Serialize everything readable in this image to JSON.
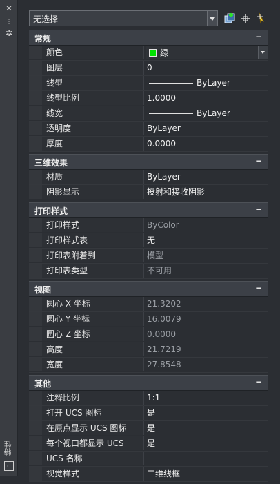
{
  "sidebar": {
    "title": "特性"
  },
  "toolbar": {
    "selection": "无选择"
  },
  "sections": {
    "general": {
      "title": "常规",
      "color": "绿",
      "color_hex": "#00e000",
      "layer_label": "图层",
      "layer": "0",
      "linetype_label": "线型",
      "linetype": "ByLayer",
      "ltscale_label": "线型比例",
      "ltscale": "1.0000",
      "lineweight_label": "线宽",
      "lineweight": "ByLayer",
      "transparency_label": "透明度",
      "transparency": "ByLayer",
      "thickness_label": "厚度",
      "thickness": "0.0000",
      "color_label": "颜色"
    },
    "three_d": {
      "title": "三维效果",
      "material_label": "材质",
      "material": "ByLayer",
      "shadow_label": "阴影显示",
      "shadow": "投射和接收阴影"
    },
    "plot": {
      "title": "打印样式",
      "style_label": "打印样式",
      "style": "ByColor",
      "table_label": "打印样式表",
      "table": "无",
      "attached_label": "打印表附着到",
      "attached": "模型",
      "type_label": "打印表类型",
      "type": "不可用"
    },
    "view": {
      "title": "视图",
      "cx_label": "圆心 X 坐标",
      "cx": "21.3202",
      "cy_label": "圆心 Y 坐标",
      "cy": "16.0079",
      "cz_label": "圆心 Z 坐标",
      "cz": "0.0000",
      "height_label": "高度",
      "height": "21.7219",
      "width_label": "宽度",
      "width": "27.8548"
    },
    "misc": {
      "title": "其他",
      "annoscale_label": "注释比例",
      "annoscale": "1:1",
      "ucsicon_label": "打开 UCS 图标",
      "ucsicon": "是",
      "ucsorigin_label": "在原点显示 UCS 图标",
      "ucsorigin": "是",
      "ucsvp_label": "每个视口都显示 UCS",
      "ucsvp": "是",
      "ucsname_label": "UCS 名称",
      "ucsname": "",
      "visual_label": "视觉样式",
      "visual": "二维线框"
    }
  }
}
